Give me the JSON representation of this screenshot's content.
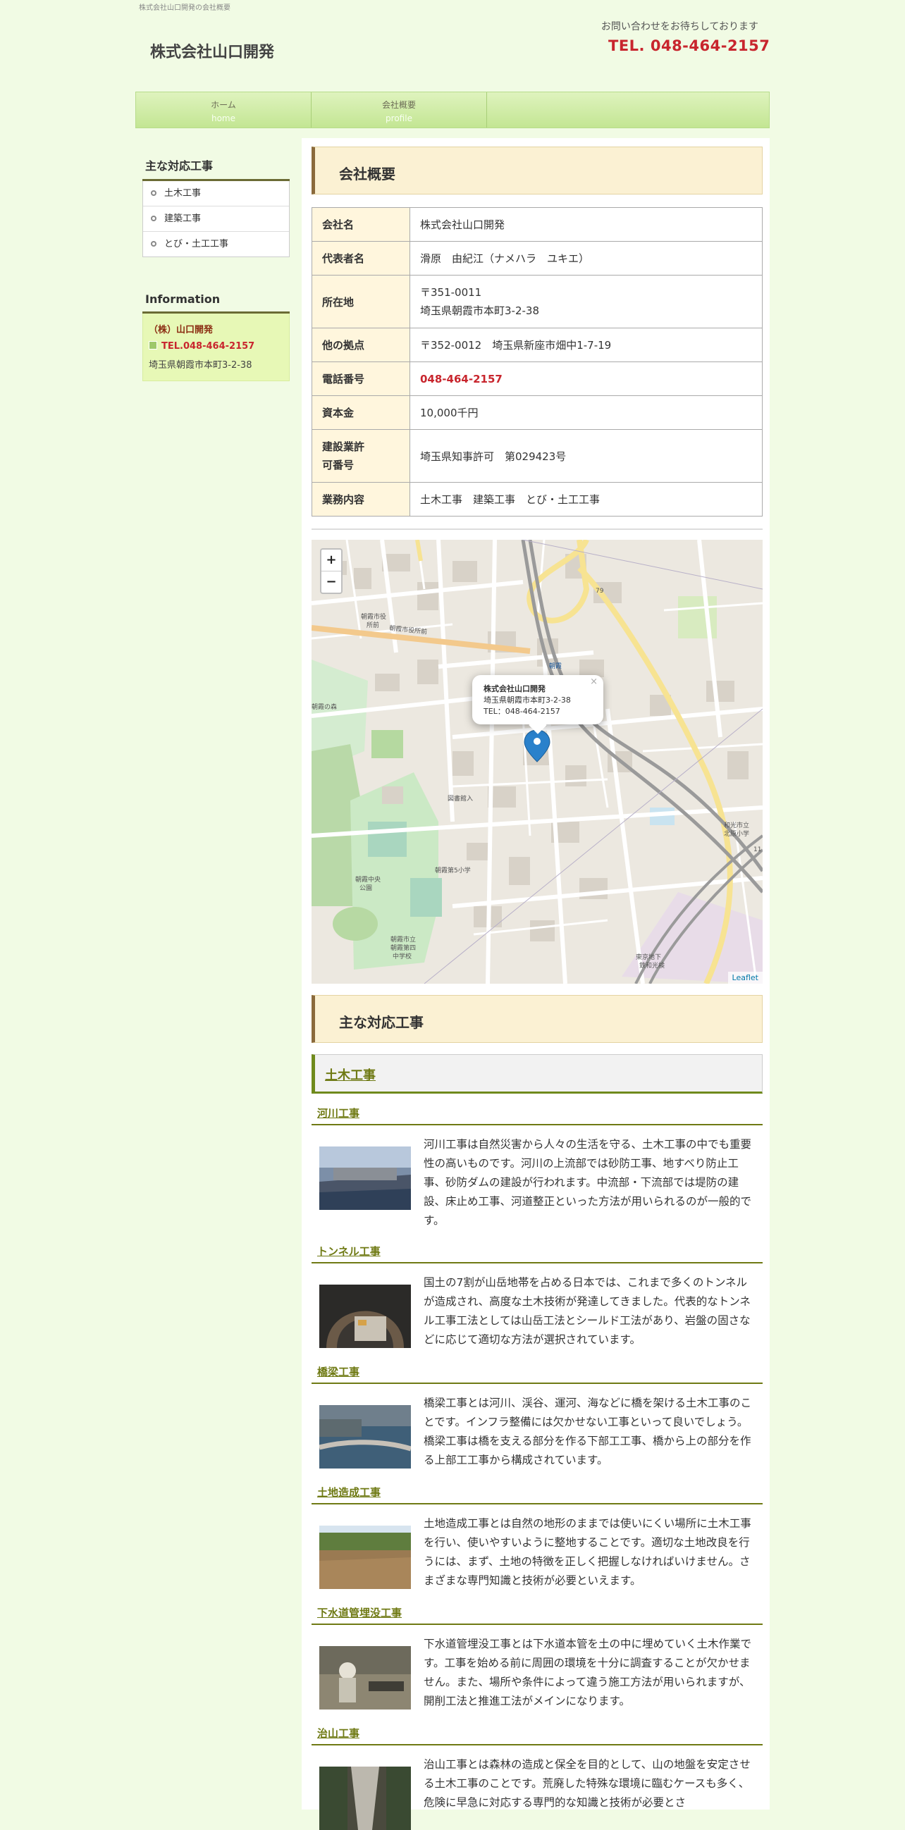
{
  "header": {
    "tagline": "株式会社山口開発の会社概要",
    "site_title": "株式会社山口開発",
    "contact_message": "お問い合わせをお待ちしております",
    "tel": "TEL. 048-464-2157"
  },
  "nav": [
    {
      "jp": "ホーム",
      "en": "home"
    },
    {
      "jp": "会社概要",
      "en": "profile"
    }
  ],
  "sidebar": {
    "works_title": "主な対応工事",
    "works": [
      "土木工事",
      "建築工事",
      "とび・土工工事"
    ],
    "info_title": "Information",
    "info_company": "（株）山口開発",
    "info_tel": "TEL.048-464-2157",
    "info_address": "埼玉県朝霞市本町3-2-38"
  },
  "profile": {
    "heading": "会社概要",
    "rows": [
      {
        "label": "会社名",
        "value": "株式会社山口開発"
      },
      {
        "label": "代表者名",
        "value": "滑原　由紀江（ナメハラ　ユキエ）"
      },
      {
        "label": "所在地",
        "value": "〒351-0011",
        "value2": "埼玉県朝霞市本町3-2-38"
      },
      {
        "label": "他の拠点",
        "value": "〒352-0012　埼玉県新座市畑中1-7-19"
      },
      {
        "label": "電話番号",
        "value": "048-464-2157"
      },
      {
        "label": "資本金",
        "value": "10,000千円"
      },
      {
        "label": "建設業許",
        "label2": "可番号",
        "value": "埼玉県知事許可　第029423号"
      },
      {
        "label": "業務内容",
        "value": "土木工事　建築工事　とび・土工工事"
      }
    ]
  },
  "map": {
    "zoom_in": "+",
    "zoom_out": "−",
    "popup_close": "×",
    "popup_name": "株式会社山口開発",
    "popup_address": "埼玉県朝霞市本町3-2-38",
    "popup_tel": "TEL：048-464-2157",
    "attribution": "Leaflet",
    "labels": [
      "朝霞市役所前",
      "朝霞市役",
      "所前",
      "79",
      "朝霞",
      "朝霞台",
      "朝霞の森",
      "図書館入",
      "朝霞第5小学校",
      "朝霞中央公園",
      "朝霞市立朝霞第四中学校",
      "和光市立北原小学校",
      "11",
      "東京地下鉄和光検車区"
    ]
  },
  "works_section": {
    "heading": "主な対応工事",
    "category": "土木工事",
    "items": [
      {
        "title": "河川工事",
        "text": "河川工事は自然災害から人々の生活を守る、土木工事の中でも重要性の高いものです。河川の上流部では砂防工事、地すべり防止工事、砂防ダムの建設が行われます。中流部・下流部では堤防の建設、床止め工事、河道整正といった方法が用いられるのが一般的です。",
        "photo": "river-construction-photo"
      },
      {
        "title": "トンネル工事",
        "text": "国土の7割が山岳地帯を占める日本では、これまで多くのトンネルが造成され、高度な土木技術が発達してきました。代表的なトンネル工事工法としては山岳工法とシールド工法があり、岩盤の固さなどに応じて適切な方法が選択されています。",
        "photo": "tunnel-construction-photo"
      },
      {
        "title": "橋梁工事",
        "text": "橋梁工事とは河川、渓谷、運河、海などに橋を架ける土木工事のことです。インフラ整備には欠かせない工事といって良いでしょう。橋梁工事は橋を支える部分を作る下部工工事、橋から上の部分を作る上部工工事から構成されています。",
        "photo": "bridge-construction-photo"
      },
      {
        "title": "土地造成工事",
        "text": "土地造成工事とは自然の地形のままでは使いにくい場所に土木工事を行い、使いやすいように整地することです。適切な土地改良を行うには、まず、土地の特徴を正しく把握しなければいけません。さまざまな専門知識と技術が必要といえます。",
        "photo": "land-development-photo"
      },
      {
        "title": "下水道管埋没工事",
        "text": "下水道管埋没工事とは下水道本管を土の中に埋めていく土木作業です。工事を始める前に周囲の環境を十分に調査することが欠かせません。また、場所や条件によって違う施工方法が用いられますが、開削工法と推進工法がメインになります。",
        "photo": "sewer-pipe-photo"
      },
      {
        "title": "治山工事",
        "text": "治山工事とは森林の造成と保全を目的として、山の地盤を安定させる土木工事のことです。荒廃した特殊な環境に臨むケースも多く、危険に早急に対応する専門的な知識と技術が必要とさ",
        "photo": "forest-conservation-photo"
      }
    ]
  },
  "colors": {
    "page_bg": "#f1fbe4",
    "accent_red": "#c8252d",
    "olive": "#6f7a14",
    "nav_green": "#c3e693",
    "heading_bg": "#fbf1d3"
  }
}
